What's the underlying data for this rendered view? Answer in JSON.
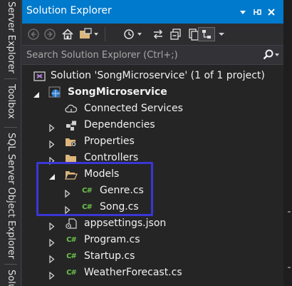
{
  "side_tabs": [
    "Server Explorer",
    "Toolbox",
    "SQL Server Object Explorer",
    "Solu"
  ],
  "panel": {
    "title": "Solution Explorer",
    "accent": "#007acc"
  },
  "search": {
    "placeholder": "Search Solution Explorer (Ctrl+;)"
  },
  "tree": {
    "solution": "Solution 'SongMicroservice' (1 of 1 project)",
    "project": "SongMicroservice",
    "connected_services": "Connected Services",
    "dependencies": "Dependencies",
    "properties": "Properties",
    "controllers": "Controllers",
    "models": "Models",
    "genre": "Genre.cs",
    "song": "Song.cs",
    "appsettings": "appsettings.json",
    "program": "Program.cs",
    "startup": "Startup.cs",
    "weather": "WeatherForecast.cs"
  },
  "icons": {
    "csharp_glyph": "C#"
  },
  "colors": {
    "highlight_box": "#3a36d6",
    "folder": "#dcb67a",
    "csharp": "#6cc24a"
  }
}
